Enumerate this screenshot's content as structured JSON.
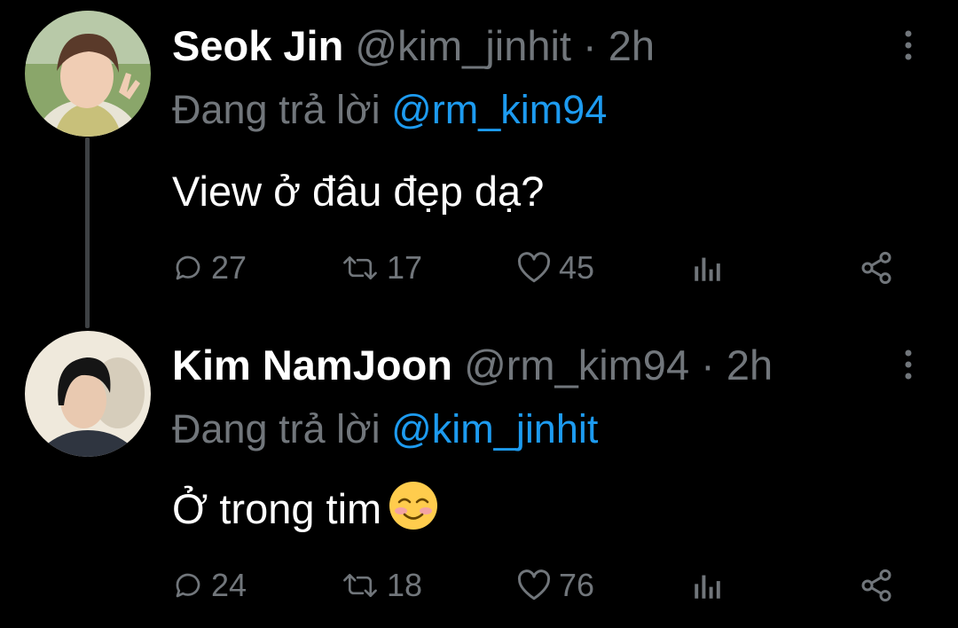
{
  "tweets": [
    {
      "name": "Seok Jin",
      "handle": "@kim_jinhit",
      "separator": "·",
      "time": "2h",
      "reply_prefix": "Đang trả lời",
      "reply_to": "@rm_kim94",
      "text": "View ở đâu đẹp dạ?",
      "emoji": "",
      "replies": "27",
      "retweets": "17",
      "likes": "45"
    },
    {
      "name": "Kim NamJoon",
      "handle": "@rm_kim94",
      "separator": "·",
      "time": "2h",
      "reply_prefix": "Đang trả lời",
      "reply_to": "@kim_jinhit",
      "text": "Ở trong tim",
      "emoji": "smiling-face-with-blushing-cheeks",
      "replies": "24",
      "retweets": "18",
      "likes": "76"
    }
  ],
  "colors": {
    "background": "#000000",
    "text": "#ffffff",
    "muted": "#71767b",
    "mention": "#1d9bf0",
    "thread_line": "#3e4144"
  },
  "icons": [
    "more-vertical-icon",
    "reply-icon",
    "retweet-icon",
    "like-icon",
    "views-icon",
    "share-icon"
  ]
}
